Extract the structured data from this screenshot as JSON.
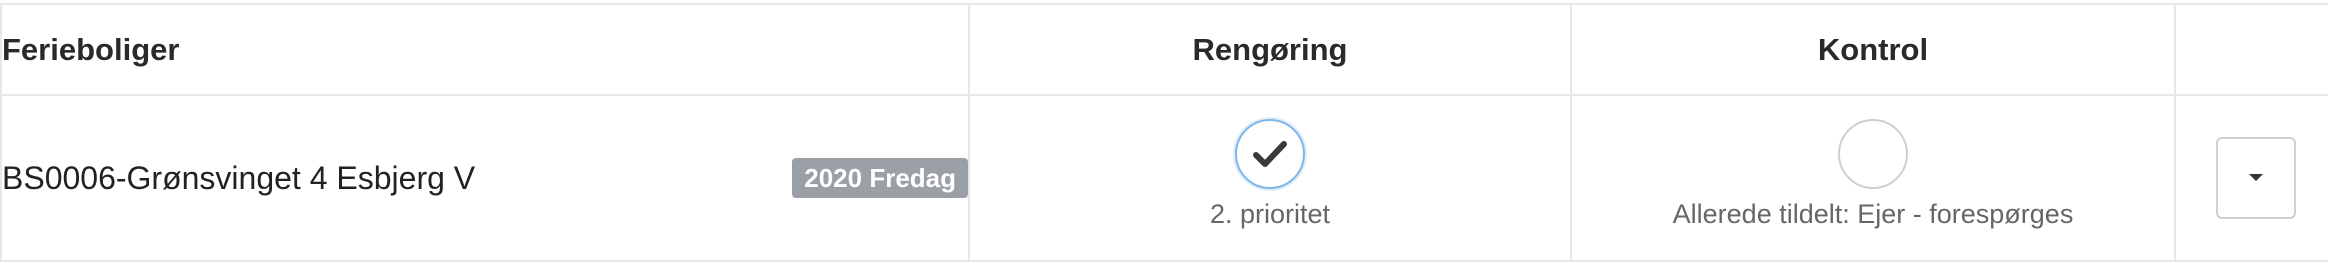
{
  "table": {
    "headers": {
      "properties": "Ferieboliger",
      "cleaning": "Rengøring",
      "control": "Kontrol",
      "actions": ""
    },
    "rows": [
      {
        "property": "BS0006-Grønsvinget 4 Esbjerg V",
        "badge": "2020 Fredag",
        "cleaning": {
          "state": "checked",
          "icon": "check-icon",
          "label": "2. prioritet"
        },
        "control": {
          "state": "unchecked",
          "icon": "empty-circle-icon",
          "label": "Allerede tildelt: Ejer - forespørges"
        },
        "actions": {
          "icon": "caret-down-icon"
        }
      }
    ]
  },
  "colors": {
    "badge_bg": "#9aa0a6",
    "check_ring": "#7fb6ea",
    "border": "#e8e8e8",
    "text": "#222222",
    "muted_text": "#666666"
  }
}
